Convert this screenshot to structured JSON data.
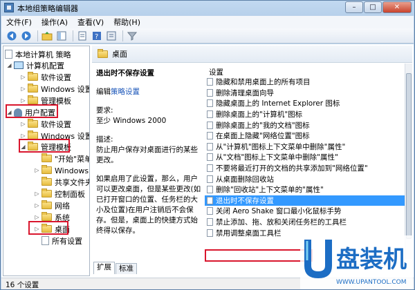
{
  "window": {
    "title": "本地组策略编辑器"
  },
  "menu": [
    "文件(F)",
    "操作(A)",
    "查看(V)",
    "帮助(H)"
  ],
  "tree": {
    "root": "本地计算机 策略",
    "computer_config": "计算机配置",
    "software_settings": "软件设置",
    "windows_settings": "Windows 设置",
    "admin_templates": "管理模板",
    "user_config": "用户配置",
    "user_software_settings": "软件设置",
    "user_windows_settings": "Windows 设置",
    "user_admin_templates": "管理模板",
    "start_menu": "\"开始\"菜单",
    "windows_components": "Windows 组件",
    "shared_folders": "共享文件夹",
    "control_panel": "控制面板",
    "network": "网络",
    "system": "系统",
    "desktop": "桌面",
    "all_settings": "所有设置"
  },
  "panel": {
    "header": "桌面",
    "desc_title": "退出时不保存设置",
    "edit_prefix": "编辑",
    "edit_link": "策略设置",
    "req_label": "要求:",
    "req_value": "至少 Windows 2000",
    "desc_label": "描述:",
    "desc_text": "防止用户保存对桌面进行的某些更改。",
    "desc_more": "如果启用了此设置，那么，用户可以更改桌面，但是某些更改(如已打开窗口的位置、任务栏的大小及位置)在用户注销后不会保存。但是，桌面上的快捷方式始终得以保存。",
    "column": "设置",
    "settings": [
      "隐藏和禁用桌面上的所有项目",
      "删除清理桌面向导",
      "隐藏桌面上的 Internet Explorer 图标",
      "删除桌面上的\"计算机\"图标",
      "删除桌面上的\"我的文档\"图标",
      "在桌面上隐藏\"网络位置\"图标",
      "从\"计算机\"图标上下文菜单中删除\"属性\"",
      "从\"文档\"图标上下文菜单中删除\"属性\"",
      "不要将最近打开的文档的共享添加到\"网络位置\"",
      "从桌面删除回收站",
      "删除\"回收站\"上下文菜单的\"属性\"",
      "退出时不保存设置",
      "关闭 Aero Shake 窗口最小化鼠标手势",
      "禁止添加、拖、放和关闭任务栏的工具栏",
      "禁用调整桌面工具栏"
    ],
    "selected_index": 11,
    "tabs": [
      "扩展",
      "标准"
    ]
  },
  "status": "16 个设置",
  "watermark": {
    "text": "U盘装机",
    "site": "WWW.UPANTOOL.COM"
  },
  "colors": {
    "highlight": "#d9152c",
    "selection": "#3399ff"
  }
}
